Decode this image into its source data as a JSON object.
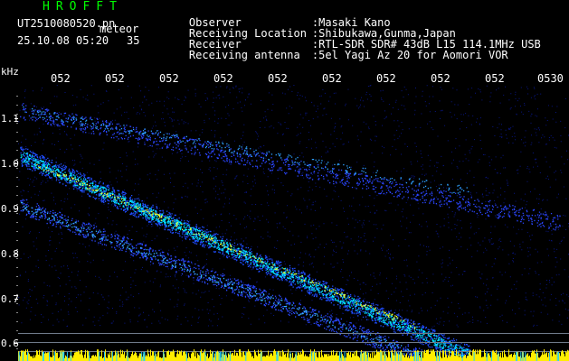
{
  "header": {
    "brand": "HROFFT",
    "filename": "UT2510080520.pn",
    "mode": "meteor",
    "datetime": "25.10.08 05:20",
    "count": "35",
    "observer_label": "Observer",
    "observer_value": ":Masaki Kano",
    "location_label": "Receiving Location",
    "location_value": ":Shibukawa,Gunma,Japan",
    "receiver_label": "Receiver",
    "receiver_value": ":RTL-SDR SDR# 43dB L15 114.1MHz USB",
    "antenna_label": "Receiving antenna",
    "antenna_value": ":5el Yagi Az 20 for Aomori VOR"
  },
  "chart_data": {
    "type": "heatmap",
    "ylabel": "kHz",
    "yticks": [
      "1.1",
      "1.0",
      "0.9",
      "0.8",
      "0.7",
      "0.6"
    ],
    "xticks": [
      "052",
      "052",
      "052",
      "052",
      "052",
      "052",
      "052",
      "052",
      "052",
      "0530"
    ],
    "colors": {
      "background": "#000000",
      "noise": "#0a1a9c",
      "signal": "#00e5ff",
      "peak": "#e6ff3c",
      "baseline": "#ffee00"
    }
  }
}
